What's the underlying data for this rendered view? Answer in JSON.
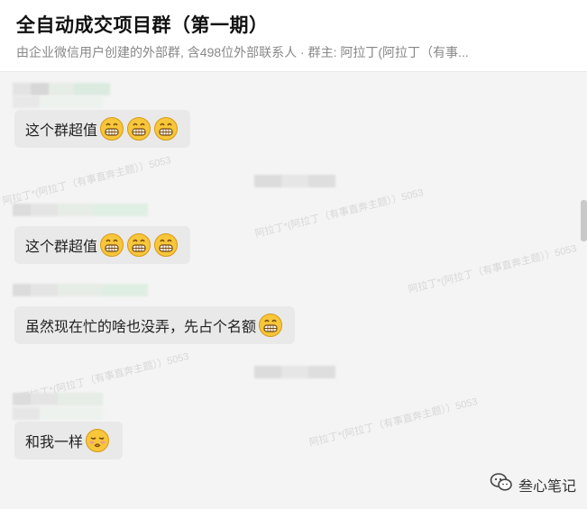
{
  "header": {
    "title": "全自动成交项目群（第一期）",
    "subtitle": "由企业微信用户创建的外部群, 含498位外部联系人 · 群主: 阿拉丁(阿拉丁（有事..."
  },
  "messages": [
    {
      "text": "这个群超值",
      "emoji_count": 3,
      "emoji": "grin-icon"
    },
    {
      "text": "这个群超值",
      "emoji_count": 3,
      "emoji": "grin-icon"
    },
    {
      "text": "虽然现在忙的啥也没弄，先占个名额",
      "emoji_count": 1,
      "emoji": "grin-icon"
    },
    {
      "text": "和我一样",
      "emoji_count": 1,
      "emoji": "smirk-icon"
    }
  ],
  "watermark": "阿拉丁*(阿拉丁（有事直奔主题））5053",
  "brand": {
    "label": "叁心笔记",
    "icon": "wechat-icon"
  }
}
